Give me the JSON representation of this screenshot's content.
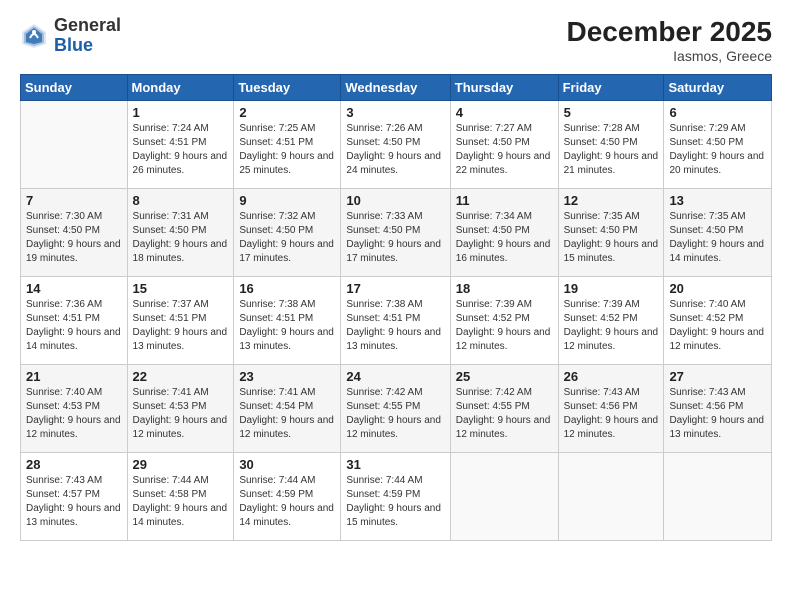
{
  "logo": {
    "general": "General",
    "blue": "Blue"
  },
  "title": "December 2025",
  "subtitle": "Iasmos, Greece",
  "days_header": [
    "Sunday",
    "Monday",
    "Tuesday",
    "Wednesday",
    "Thursday",
    "Friday",
    "Saturday"
  ],
  "weeks": [
    [
      {
        "num": "",
        "rise": "",
        "set": "",
        "daylight": ""
      },
      {
        "num": "1",
        "rise": "Sunrise: 7:24 AM",
        "set": "Sunset: 4:51 PM",
        "daylight": "Daylight: 9 hours and 26 minutes."
      },
      {
        "num": "2",
        "rise": "Sunrise: 7:25 AM",
        "set": "Sunset: 4:51 PM",
        "daylight": "Daylight: 9 hours and 25 minutes."
      },
      {
        "num": "3",
        "rise": "Sunrise: 7:26 AM",
        "set": "Sunset: 4:50 PM",
        "daylight": "Daylight: 9 hours and 24 minutes."
      },
      {
        "num": "4",
        "rise": "Sunrise: 7:27 AM",
        "set": "Sunset: 4:50 PM",
        "daylight": "Daylight: 9 hours and 22 minutes."
      },
      {
        "num": "5",
        "rise": "Sunrise: 7:28 AM",
        "set": "Sunset: 4:50 PM",
        "daylight": "Daylight: 9 hours and 21 minutes."
      },
      {
        "num": "6",
        "rise": "Sunrise: 7:29 AM",
        "set": "Sunset: 4:50 PM",
        "daylight": "Daylight: 9 hours and 20 minutes."
      }
    ],
    [
      {
        "num": "7",
        "rise": "Sunrise: 7:30 AM",
        "set": "Sunset: 4:50 PM",
        "daylight": "Daylight: 9 hours and 19 minutes."
      },
      {
        "num": "8",
        "rise": "Sunrise: 7:31 AM",
        "set": "Sunset: 4:50 PM",
        "daylight": "Daylight: 9 hours and 18 minutes."
      },
      {
        "num": "9",
        "rise": "Sunrise: 7:32 AM",
        "set": "Sunset: 4:50 PM",
        "daylight": "Daylight: 9 hours and 17 minutes."
      },
      {
        "num": "10",
        "rise": "Sunrise: 7:33 AM",
        "set": "Sunset: 4:50 PM",
        "daylight": "Daylight: 9 hours and 17 minutes."
      },
      {
        "num": "11",
        "rise": "Sunrise: 7:34 AM",
        "set": "Sunset: 4:50 PM",
        "daylight": "Daylight: 9 hours and 16 minutes."
      },
      {
        "num": "12",
        "rise": "Sunrise: 7:35 AM",
        "set": "Sunset: 4:50 PM",
        "daylight": "Daylight: 9 hours and 15 minutes."
      },
      {
        "num": "13",
        "rise": "Sunrise: 7:35 AM",
        "set": "Sunset: 4:50 PM",
        "daylight": "Daylight: 9 hours and 14 minutes."
      }
    ],
    [
      {
        "num": "14",
        "rise": "Sunrise: 7:36 AM",
        "set": "Sunset: 4:51 PM",
        "daylight": "Daylight: 9 hours and 14 minutes."
      },
      {
        "num": "15",
        "rise": "Sunrise: 7:37 AM",
        "set": "Sunset: 4:51 PM",
        "daylight": "Daylight: 9 hours and 13 minutes."
      },
      {
        "num": "16",
        "rise": "Sunrise: 7:38 AM",
        "set": "Sunset: 4:51 PM",
        "daylight": "Daylight: 9 hours and 13 minutes."
      },
      {
        "num": "17",
        "rise": "Sunrise: 7:38 AM",
        "set": "Sunset: 4:51 PM",
        "daylight": "Daylight: 9 hours and 13 minutes."
      },
      {
        "num": "18",
        "rise": "Sunrise: 7:39 AM",
        "set": "Sunset: 4:52 PM",
        "daylight": "Daylight: 9 hours and 12 minutes."
      },
      {
        "num": "19",
        "rise": "Sunrise: 7:39 AM",
        "set": "Sunset: 4:52 PM",
        "daylight": "Daylight: 9 hours and 12 minutes."
      },
      {
        "num": "20",
        "rise": "Sunrise: 7:40 AM",
        "set": "Sunset: 4:52 PM",
        "daylight": "Daylight: 9 hours and 12 minutes."
      }
    ],
    [
      {
        "num": "21",
        "rise": "Sunrise: 7:40 AM",
        "set": "Sunset: 4:53 PM",
        "daylight": "Daylight: 9 hours and 12 minutes."
      },
      {
        "num": "22",
        "rise": "Sunrise: 7:41 AM",
        "set": "Sunset: 4:53 PM",
        "daylight": "Daylight: 9 hours and 12 minutes."
      },
      {
        "num": "23",
        "rise": "Sunrise: 7:41 AM",
        "set": "Sunset: 4:54 PM",
        "daylight": "Daylight: 9 hours and 12 minutes."
      },
      {
        "num": "24",
        "rise": "Sunrise: 7:42 AM",
        "set": "Sunset: 4:55 PM",
        "daylight": "Daylight: 9 hours and 12 minutes."
      },
      {
        "num": "25",
        "rise": "Sunrise: 7:42 AM",
        "set": "Sunset: 4:55 PM",
        "daylight": "Daylight: 9 hours and 12 minutes."
      },
      {
        "num": "26",
        "rise": "Sunrise: 7:43 AM",
        "set": "Sunset: 4:56 PM",
        "daylight": "Daylight: 9 hours and 12 minutes."
      },
      {
        "num": "27",
        "rise": "Sunrise: 7:43 AM",
        "set": "Sunset: 4:56 PM",
        "daylight": "Daylight: 9 hours and 13 minutes."
      }
    ],
    [
      {
        "num": "28",
        "rise": "Sunrise: 7:43 AM",
        "set": "Sunset: 4:57 PM",
        "daylight": "Daylight: 9 hours and 13 minutes."
      },
      {
        "num": "29",
        "rise": "Sunrise: 7:44 AM",
        "set": "Sunset: 4:58 PM",
        "daylight": "Daylight: 9 hours and 14 minutes."
      },
      {
        "num": "30",
        "rise": "Sunrise: 7:44 AM",
        "set": "Sunset: 4:59 PM",
        "daylight": "Daylight: 9 hours and 14 minutes."
      },
      {
        "num": "31",
        "rise": "Sunrise: 7:44 AM",
        "set": "Sunset: 4:59 PM",
        "daylight": "Daylight: 9 hours and 15 minutes."
      },
      {
        "num": "",
        "rise": "",
        "set": "",
        "daylight": ""
      },
      {
        "num": "",
        "rise": "",
        "set": "",
        "daylight": ""
      },
      {
        "num": "",
        "rise": "",
        "set": "",
        "daylight": ""
      }
    ]
  ]
}
